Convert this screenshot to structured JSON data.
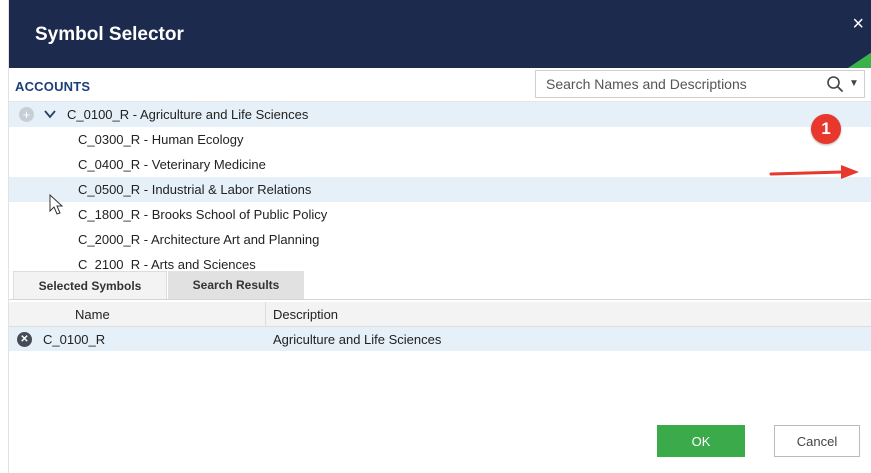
{
  "dialog": {
    "title": "Symbol Selector",
    "close_glyph": "×",
    "accent_color": "#3bb34a",
    "header_color": "#1c2a4d"
  },
  "accounts": {
    "label": "ACCOUNTS"
  },
  "search": {
    "placeholder": "Search Names and Descriptions",
    "icon": "search-icon",
    "dropdown_icon": "caret-down-icon"
  },
  "tree": {
    "rows": [
      {
        "label": "C_0100_R - Agriculture and Life Sciences",
        "expanded": true,
        "selected": true
      },
      {
        "label": "C_0300_R - Human Ecology",
        "selected": false
      },
      {
        "label": "C_0400_R - Veterinary Medicine",
        "selected": false
      },
      {
        "label": "C_0500_R - Industrial & Labor Relations",
        "selected": true
      },
      {
        "label": "C_1800_R - Brooks School of Public Policy",
        "selected": false
      },
      {
        "label": "C_2000_R - Architecture Art and Planning",
        "selected": false
      },
      {
        "label": "C_2100_R - Arts and Sciences",
        "selected": false
      }
    ]
  },
  "annotation": {
    "badge": "1",
    "color": "#e8372d"
  },
  "tabs": {
    "selected_symbols": "Selected Symbols",
    "search_results": "Search Results"
  },
  "grid": {
    "columns": [
      "Name",
      "Description"
    ],
    "rows": [
      {
        "name": "C_0100_R",
        "description": "Agriculture and Life Sciences"
      }
    ]
  },
  "buttons": {
    "ok": "OK",
    "cancel": "Cancel",
    "ok_color": "#3aaa4a"
  }
}
